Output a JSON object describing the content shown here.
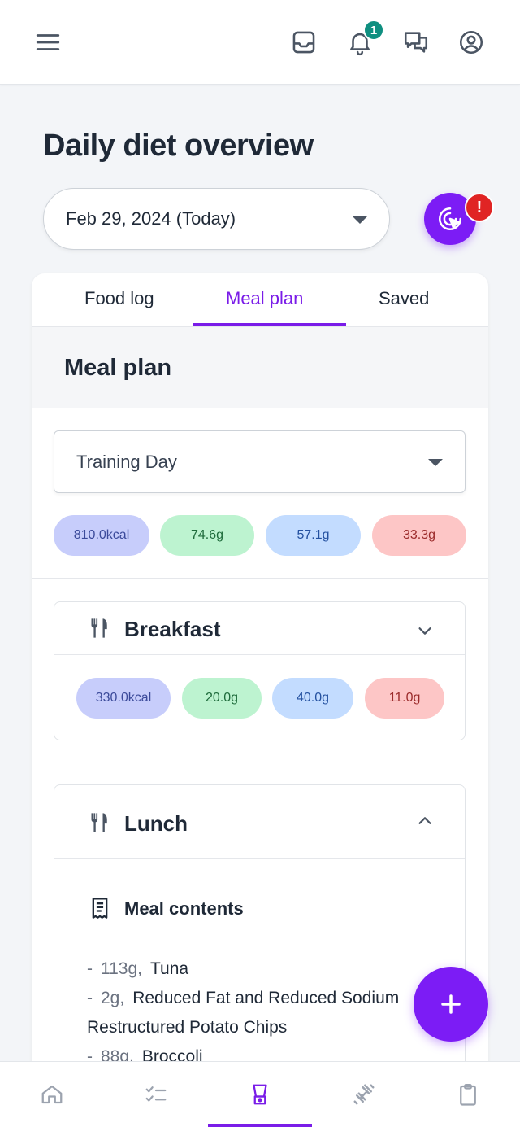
{
  "header": {
    "icons": [
      "menu-icon",
      "inbox-icon",
      "bell-icon",
      "chat-icon",
      "account-icon"
    ],
    "notification_count": "1"
  },
  "page": {
    "title": "Daily diet overview",
    "date_value": "Feb 29, 2024 (Today)",
    "alert_badge": "!"
  },
  "tabs": [
    {
      "label": "Food log",
      "active": false
    },
    {
      "label": "Meal plan",
      "active": true
    },
    {
      "label": "Saved",
      "active": false
    }
  ],
  "meal_plan": {
    "section_title": "Meal plan",
    "plan_select_value": "Training Day",
    "totals": {
      "kcal": "810.0kcal",
      "protein": "74.6g",
      "carbs": "57.1g",
      "fat": "33.3g"
    }
  },
  "meals": [
    {
      "name": "Breakfast",
      "expanded": false,
      "totals": {
        "kcal": "330.0kcal",
        "protein": "20.0g",
        "carbs": "40.0g",
        "fat": "11.0g"
      }
    },
    {
      "name": "Lunch",
      "expanded": true,
      "contents_title": "Meal contents",
      "items": [
        {
          "qty": "113g,",
          "name": "Tuna"
        },
        {
          "qty": "2g,",
          "name": "Reduced Fat and Reduced Sodium Restructured Potato Chips"
        },
        {
          "qty": "88g,",
          "name": "Broccoli"
        }
      ]
    }
  ],
  "bottom_nav": {
    "items": [
      "home-icon",
      "checklist-icon",
      "blender-icon",
      "dumbbell-icon",
      "clipboard-icon"
    ],
    "active": "blender-icon"
  },
  "colors": {
    "accent": "#7c1cf5",
    "kcal_pill": "#c7cdfb",
    "protein_pill": "#bdf3d0",
    "carbs_pill": "#c3dcff",
    "fat_pill": "#fdc6c6",
    "notification": "#0f8f80",
    "alert": "#e02424"
  }
}
